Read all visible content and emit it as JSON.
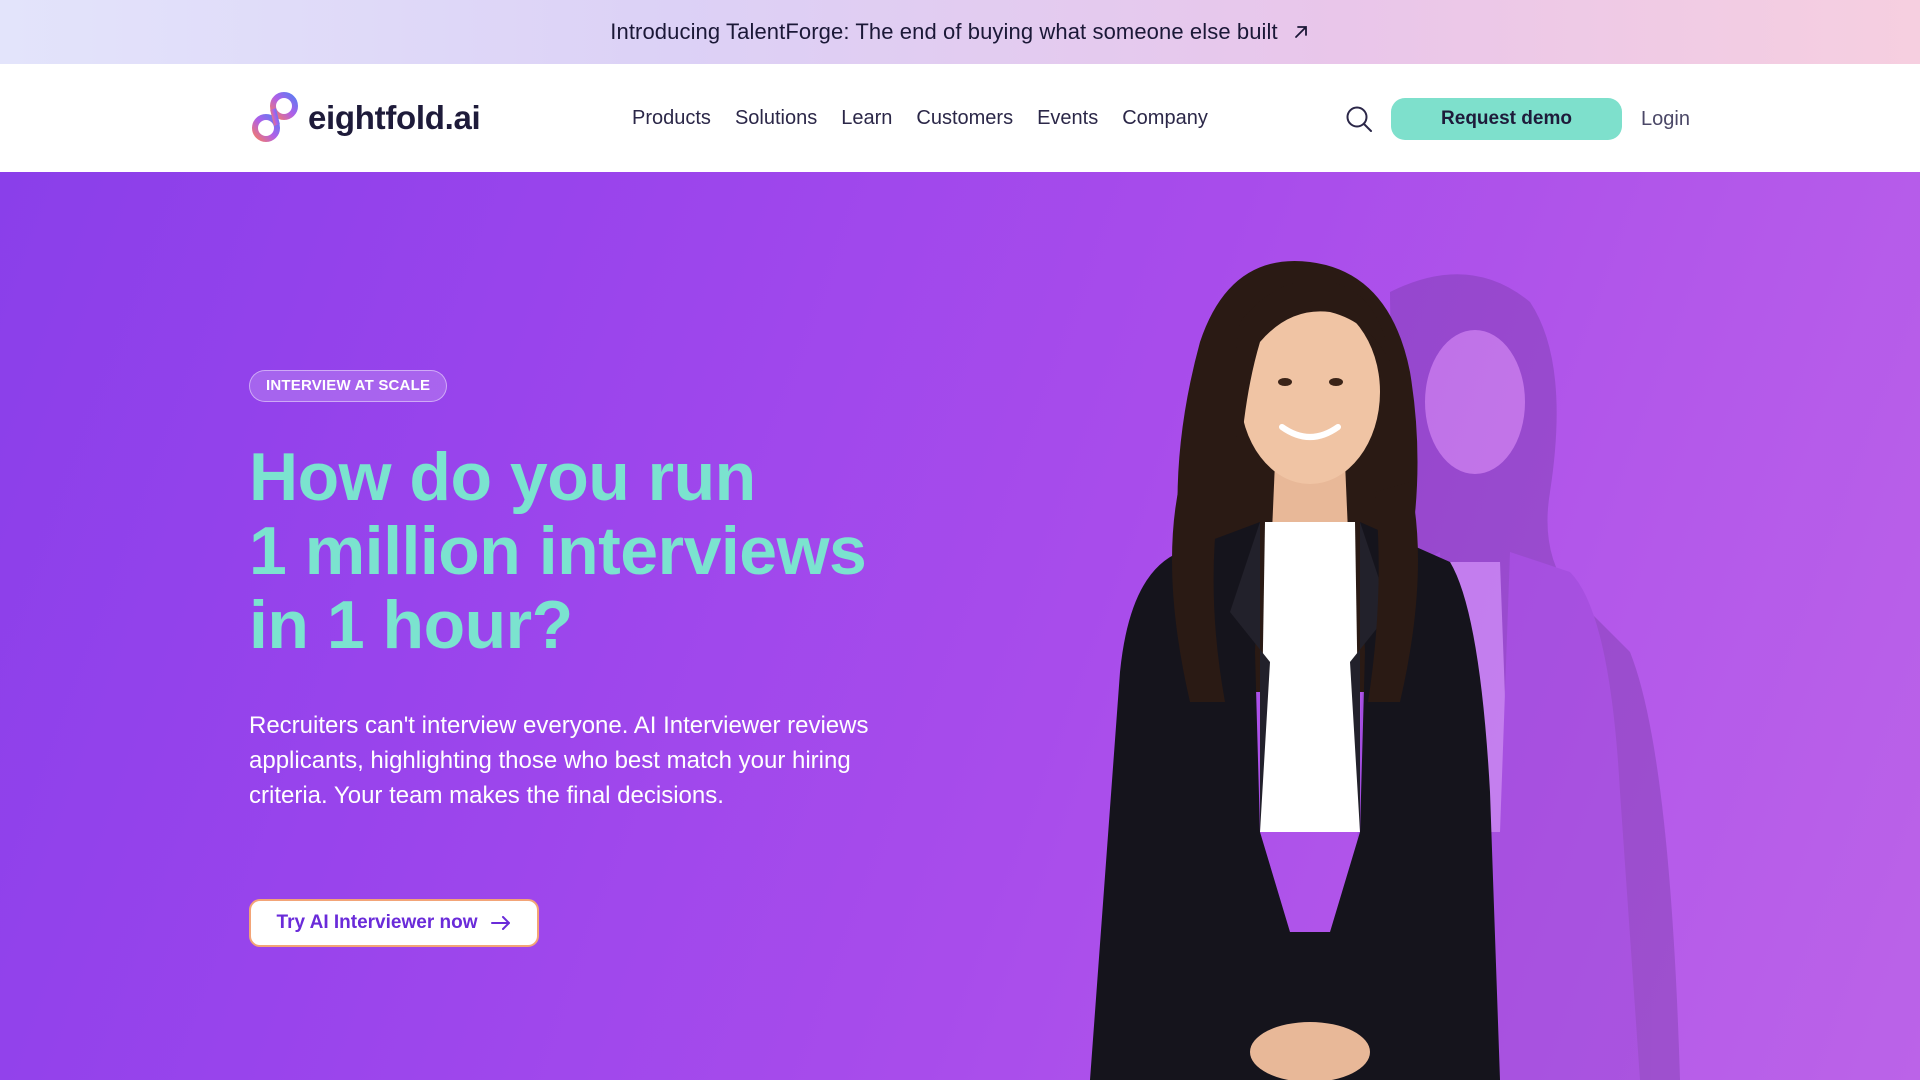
{
  "announcement": {
    "text": "Introducing TalentForge: The end of buying what someone else built",
    "arrow_icon": "arrow-up-right-icon"
  },
  "header": {
    "logo_text": "eightfold.ai",
    "nav": [
      {
        "label": "Products"
      },
      {
        "label": "Solutions"
      },
      {
        "label": "Learn"
      },
      {
        "label": "Customers"
      },
      {
        "label": "Events"
      },
      {
        "label": "Company"
      }
    ],
    "search_icon": "search-icon",
    "demo_label": "Request demo",
    "login_label": "Login"
  },
  "hero": {
    "badge": "INTERVIEW AT SCALE",
    "headline_lines": [
      "How do you run",
      "1 million interviews",
      "in 1 hour?"
    ],
    "body": "Recruiters can't interview everyone. AI Interviewer reviews applicants, highlighting those who best match your hiring criteria. Your team makes the final decisions.",
    "cta_label": "Try AI Interviewer now",
    "cta_icon": "arrow-right-icon"
  },
  "colors": {
    "accent_mint": "#7ee0cc",
    "headline_mint": "#7be3cf",
    "hero_purple": "#9b45ec",
    "cta_text": "#6a2bd9"
  }
}
